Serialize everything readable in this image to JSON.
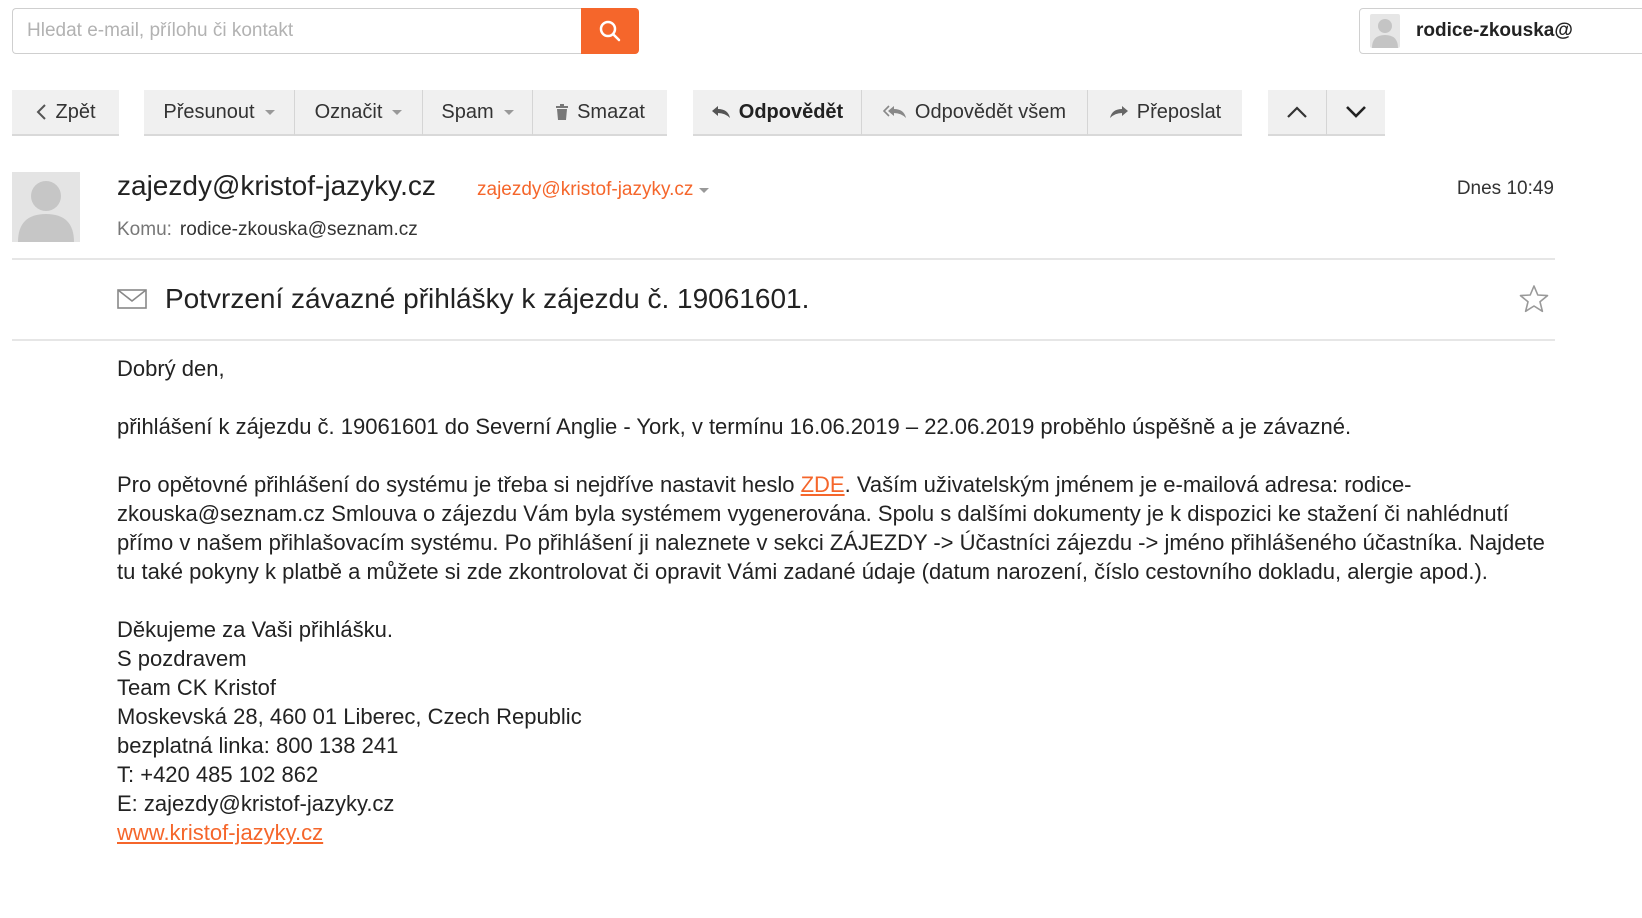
{
  "search": {
    "placeholder": "Hledat e-mail, přílohu či kontakt"
  },
  "user": {
    "name": "rodice-zkouska@"
  },
  "toolbar": {
    "back": "Zpět",
    "move": "Přesunout",
    "mark": "Označit",
    "spam": "Spam",
    "delete": "Smazat",
    "reply": "Odpovědět",
    "reply_all": "Odpovědět všem",
    "forward": "Přeposlat"
  },
  "message": {
    "sender_name": "zajezdy@kristof-jazyky.cz",
    "sender_email": "zajezdy@kristof-jazyky.cz",
    "date": "Dnes 10:49",
    "to_label": "Komu:",
    "to": "rodice-zkouska@seznam.cz",
    "subject": "Potvrzení závazné přihlášky k zájezdu č. 19061601.",
    "greeting": "Dobrý den,",
    "para1": "přihlášení k zájezdu č. 19061601 do Severní Anglie - York, v termínu 16.06.2019 – 22.06.2019 proběhlo úspěšně a je závazné.",
    "para2_before": "Pro opětovné přihlášení do systému je třeba si nejdříve nastavit heslo ",
    "para2_link": "ZDE",
    "para2_after": ". Vaším uživatelským jménem je e-mailová adresa: rodice-zkouska@seznam.cz Smlouva o zájezdu Vám byla systémem vygenerována. Spolu s dalšími dokumenty je k dispozici ke stažení či nahlédnutí přímo v našem přihlašovacím systému. Po přihlášení ji naleznete v sekci ZÁJEZDY -> Účastníci zájezdu -> jméno přihlášeného účastníka. Najdete tu také pokyny k platbě a můžete si zde zkontrolovat či opravit Vámi zadané údaje (datum narození, číslo cestovního dokladu, alergie apod.).",
    "signature": [
      "Děkujeme za Vaši přihlášku.",
      "S pozdravem",
      "Team CK Kristof",
      "Moskevská 28, 460 01 Liberec, Czech Republic",
      "bezplatná linka: 800 138 241",
      "T: +420 485 102 862",
      "E: zajezdy@kristof-jazyky.cz"
    ],
    "website": "www.kristof-jazyky.cz"
  },
  "colors": {
    "accent": "#f5662b"
  }
}
